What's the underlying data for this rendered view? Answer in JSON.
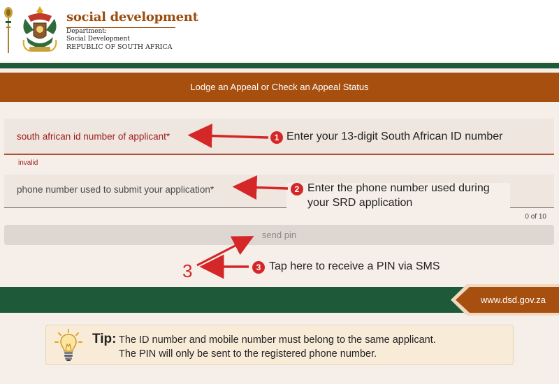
{
  "header": {
    "brand_name": "social development",
    "department_line1": "Department:",
    "department_line2": "Social Development",
    "country": "REPUBLIC OF SOUTH AFRICA"
  },
  "title_bar": {
    "title": "Lodge an Appeal or Check an Appeal Status"
  },
  "form": {
    "id_field": {
      "label": "south african id number of applicant*",
      "error": "invalid"
    },
    "phone_field": {
      "label": "phone number used to submit your application*",
      "counter": "0 of 10"
    },
    "send_button": "send pin"
  },
  "annotations": {
    "step1": {
      "badge": "1",
      "text": "Enter your 13-digit South African ID number"
    },
    "step2": {
      "badge": "2",
      "text_line1": "Enter the phone number used during",
      "text_line2": "your SRD application"
    },
    "step3": {
      "badge": "3",
      "text": "Tap here to receive a PIN via SMS",
      "handwritten_number": "3"
    }
  },
  "footer": {
    "url": "www.dsd.gov.za"
  },
  "tip": {
    "label": "Tip:",
    "line1": "The ID number and mobile number must belong to the same applicant.",
    "line2": "The PIN will only be sent to the registered phone number."
  },
  "colors": {
    "brand_brown": "#a64f0f",
    "brand_green": "#1e5a3a",
    "error_red": "#9b1c1c",
    "annotation_red": "#d42727",
    "page_background": "#f6efe9",
    "tip_background": "#f8ecd9"
  },
  "icons": [
    "mace-icon",
    "coat-of-arms-icon",
    "lightbulb-icon",
    "arrow-icon"
  ]
}
